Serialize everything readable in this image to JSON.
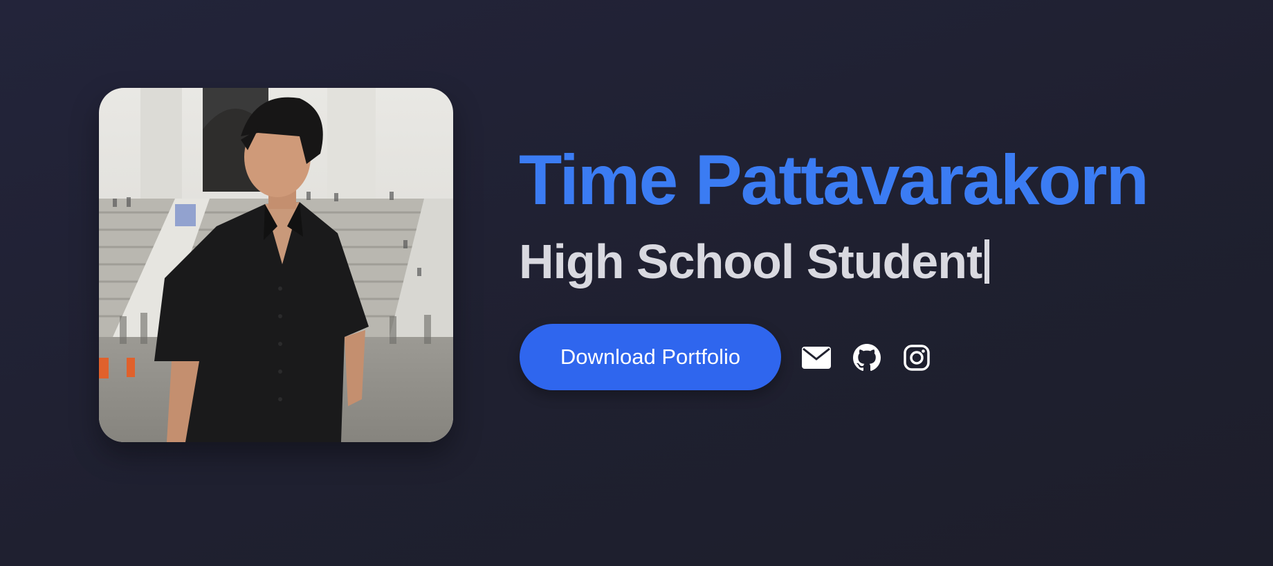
{
  "profile": {
    "name": "Time Pattavarakorn",
    "role": "High School Student"
  },
  "actions": {
    "download_label": "Download Portfolio"
  },
  "social": [
    {
      "icon": "mail-icon"
    },
    {
      "icon": "github-icon"
    },
    {
      "icon": "instagram-icon"
    }
  ],
  "colors": {
    "background": "#21222f",
    "name": "#3b7cf3",
    "role": "#d9d9e0",
    "button": "#2f66ee",
    "button_text": "#ffffff"
  }
}
